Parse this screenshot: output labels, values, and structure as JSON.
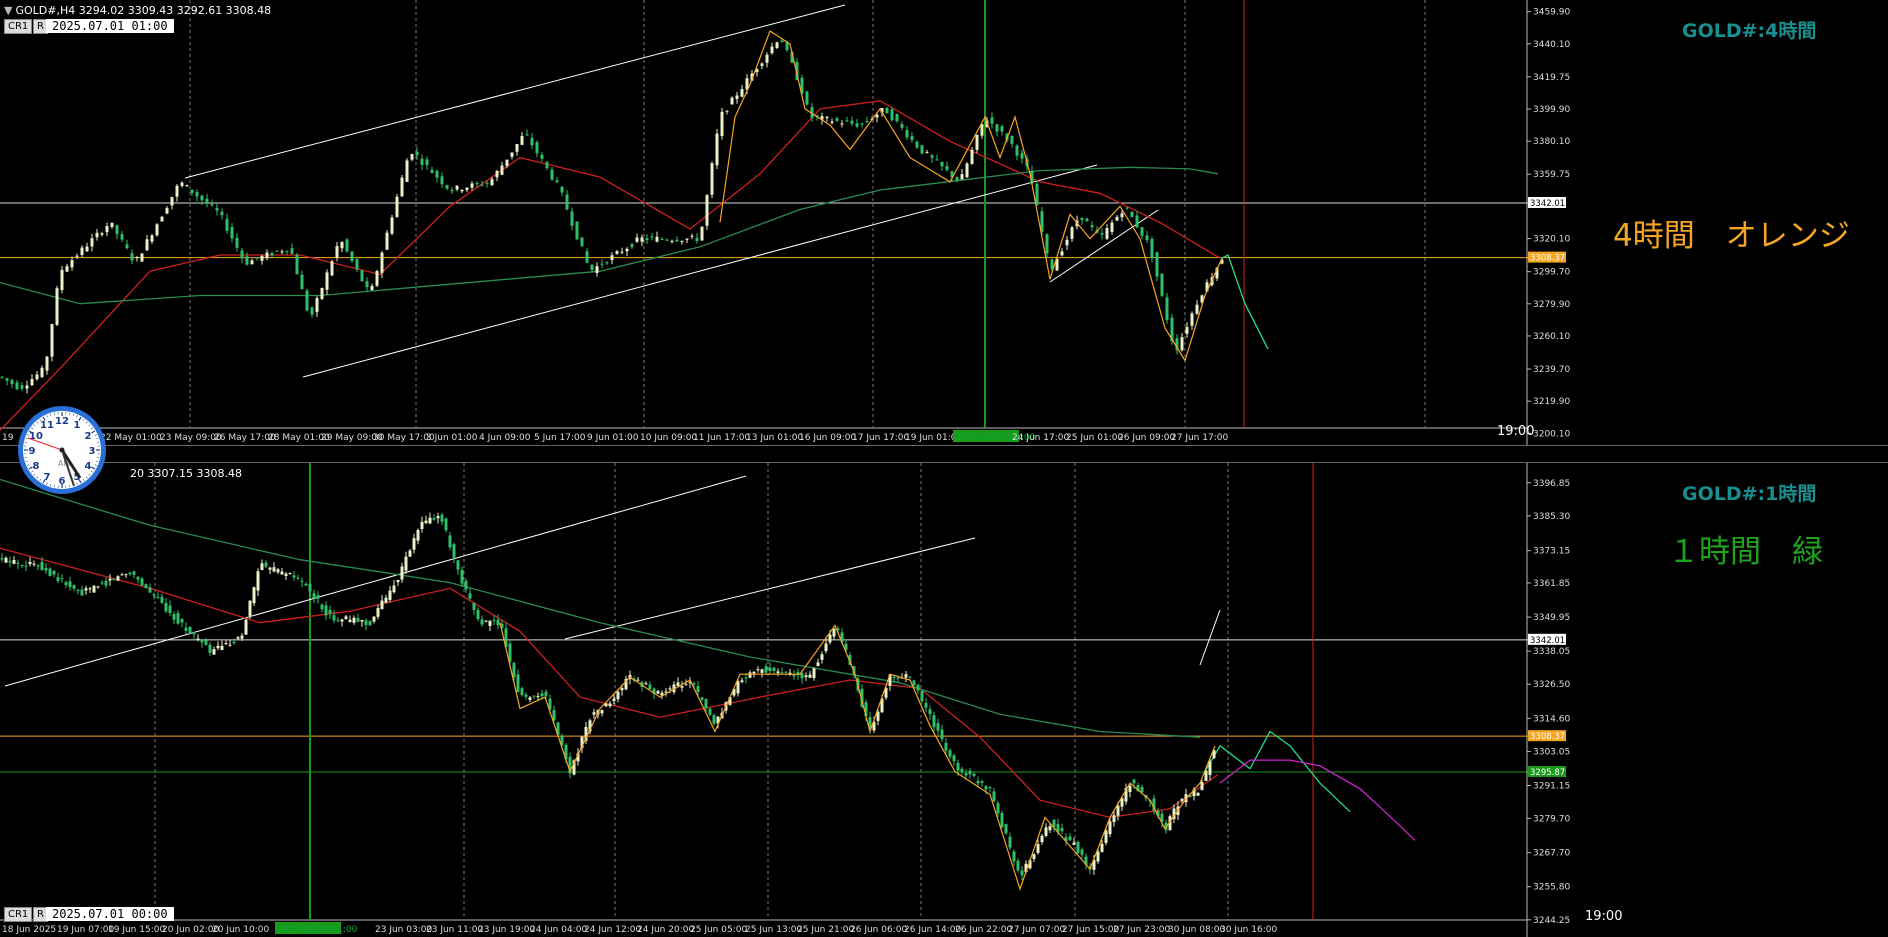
{
  "top": {
    "info": "GOLD#,H4  3294.02 3309.43 3292.61 3308.48",
    "cr_button": "CR1",
    "r_button": "R",
    "date_label": "2025.07.01 01:00",
    "symbol_title": "GOLD#:4時間",
    "annotation": "4時間　オレンジ",
    "annotation_color": "#f5a623",
    "time_marker": "19:00",
    "hline_white_price": "3342.01",
    "hline_orange_price": "3308.37",
    "x_labels": [
      "19",
      "22 May 01:00",
      "23 May 09:00",
      "26 May 17:00",
      "28 May 01:00",
      "29 May 09:00",
      "30 May 17:00",
      "3 Jun 01:00",
      "4 Jun 09:00",
      "5 Jun 17:00",
      "9 Jun 01:00",
      "10 Jun 09:00",
      "11 Jun 17:00",
      "13 Jun 01:00",
      "16 Jun 09:00",
      "17 Jun 17:00",
      "19 Jun 01:00",
      "2025.06.23 01:00",
      "24 Jun 17:00",
      "25 Jun 01:00",
      "26 Jun 09:00",
      "27 Jun 17:00"
    ]
  },
  "bottom": {
    "info": "20 3307.15 3308.48",
    "cr_button": "CR1",
    "r_button": "R",
    "date_label": "2025.07.01 00:00",
    "symbol_title": "GOLD#:1時間",
    "annotation": "１時間　緑",
    "annotation_color": "#1fa31f",
    "time_marker": "19:00",
    "hline_white_price": "3342.01",
    "hline_orange_price": "3308.37",
    "hline_green_price": "3295.87",
    "x_labels": [
      "18 Jun 2025",
      "19 Jun 07:00",
      "19 Jun 15:00",
      "20 Jun 02:00",
      "20 Jun 10:00",
      "2025.06.23 01:00",
      "23 Jun 03:00",
      "23 Jun 11:00",
      "23 Jun 19:00",
      "24 Jun 04:00",
      "24 Jun 12:00",
      "24 Jun 20:00",
      "25 Jun 05:00",
      "25 Jun 13:00",
      "25 Jun 21:00",
      "26 Jun 06:00",
      "26 Jun 14:00",
      "26 Jun 22:00",
      "27 Jun 07:00",
      "27 Jun 15:00",
      "27 Jun 23:00",
      "30 Jun 08:00",
      "30 Jun 16:00"
    ]
  },
  "clock": {
    "label": "AM",
    "numbers": [
      "12",
      "1",
      "2",
      "3",
      "4",
      "5",
      "6",
      "7",
      "8",
      "9",
      "10",
      "11"
    ]
  },
  "colors": {
    "bull": "#e8f0c8",
    "bear": "#2fbf6a",
    "ma_red": "#cc2020",
    "ma_green": "#2a8a50",
    "zigzag": "#f5a623",
    "trend": "#ffffff",
    "proj_green": "#22dd88",
    "proj_magenta": "#cc22cc",
    "marker_red": "#cc2020",
    "marker_green": "#1a9a1a"
  },
  "chart_data": [
    {
      "type": "candlestick",
      "title": "GOLD#:4時間",
      "timeframe": "H4",
      "x_labels": [
        "19",
        "22 May 01:00",
        "23 May 09:00",
        "26 May 17:00",
        "28 May 01:00",
        "29 May 09:00",
        "30 May 17:00",
        "3 Jun 01:00",
        "4 Jun 09:00",
        "5 Jun 17:00",
        "9 Jun 01:00",
        "10 Jun 09:00",
        "11 Jun 17:00",
        "13 Jun 01:00",
        "16 Jun 09:00",
        "17 Jun 17:00",
        "19 Jun 01:00",
        "2025.06.23 01:00",
        "24 Jun 17:00",
        "25 Jun 01:00",
        "26 Jun 09:00",
        "27 Jun 17:00"
      ],
      "y_ticks": [
        3459.9,
        3440.1,
        3419.75,
        3399.9,
        3380.1,
        3359.75,
        3342.01,
        3320.1,
        3308.37,
        3299.7,
        3279.9,
        3260.1,
        3239.7,
        3219.9,
        3200.1
      ],
      "ylim": [
        3196,
        3464
      ],
      "price_path": [
        [
          0,
          3235
        ],
        [
          20,
          3228
        ],
        [
          45,
          3240
        ],
        [
          60,
          3300
        ],
        [
          110,
          3330
        ],
        [
          135,
          3305
        ],
        [
          180,
          3355
        ],
        [
          220,
          3335
        ],
        [
          245,
          3305
        ],
        [
          290,
          3315
        ],
        [
          310,
          3270
        ],
        [
          340,
          3320
        ],
        [
          370,
          3285
        ],
        [
          410,
          3375
        ],
        [
          450,
          3350
        ],
        [
          490,
          3355
        ],
        [
          525,
          3385
        ],
        [
          560,
          3350
        ],
        [
          590,
          3300
        ],
        [
          640,
          3320
        ],
        [
          700,
          3320
        ],
        [
          720,
          3395
        ],
        [
          750,
          3420
        ],
        [
          780,
          3445
        ],
        [
          800,
          3415
        ],
        [
          810,
          3395
        ],
        [
          860,
          3390
        ],
        [
          885,
          3400
        ],
        [
          920,
          3375
        ],
        [
          960,
          3355
        ],
        [
          985,
          3395
        ],
        [
          1010,
          3380
        ],
        [
          1030,
          3360
        ],
        [
          1050,
          3300
        ],
        [
          1080,
          3335
        ],
        [
          1100,
          3320
        ],
        [
          1125,
          3340
        ],
        [
          1150,
          3315
        ],
        [
          1175,
          3250
        ],
        [
          1200,
          3285
        ],
        [
          1222,
          3308
        ]
      ],
      "series": [
        {
          "name": "MA red",
          "values": [
            [
              0,
              3202
            ],
            [
              60,
              3240
            ],
            [
              150,
              3300
            ],
            [
              220,
              3310
            ],
            [
              300,
              3310
            ],
            [
              380,
              3298
            ],
            [
              450,
              3340
            ],
            [
              520,
              3370
            ],
            [
              600,
              3358
            ],
            [
              690,
              3326
            ],
            [
              760,
              3360
            ],
            [
              820,
              3400
            ],
            [
              880,
              3405
            ],
            [
              950,
              3380
            ],
            [
              1040,
              3355
            ],
            [
              1100,
              3348
            ],
            [
              1160,
              3330
            ],
            [
              1220,
              3308
            ]
          ]
        },
        {
          "name": "MA green",
          "values": [
            [
              0,
              3293
            ],
            [
              80,
              3280
            ],
            [
              200,
              3285
            ],
            [
              320,
              3285
            ],
            [
              450,
              3292
            ],
            [
              600,
              3300
            ],
            [
              700,
              3315
            ],
            [
              800,
              3338
            ],
            [
              880,
              3350
            ],
            [
              960,
              3356
            ],
            [
              1040,
              3362
            ],
            [
              1130,
              3364
            ],
            [
              1190,
              3363
            ],
            [
              1218,
              3360
            ]
          ]
        },
        {
          "name": "Forecast",
          "values": [
            [
              1222,
              3308
            ],
            [
              1228,
              3310
            ],
            [
              1245,
              3280
            ],
            [
              1268,
              3252
            ]
          ]
        }
      ],
      "hlines": [
        3342.01,
        3308.37
      ]
    },
    {
      "type": "candlestick",
      "title": "GOLD#:1時間",
      "timeframe": "H1",
      "x_labels": [
        "18 Jun 2025",
        "19 Jun 07:00",
        "19 Jun 15:00",
        "20 Jun 02:00",
        "20 Jun 10:00",
        "2025.06.23 01:00",
        "23 Jun 03:00",
        "23 Jun 11:00",
        "23 Jun 19:00",
        "24 Jun 04:00",
        "24 Jun 12:00",
        "24 Jun 20:00",
        "25 Jun 05:00",
        "25 Jun 13:00",
        "25 Jun 21:00",
        "26 Jun 06:00",
        "26 Jun 14:00",
        "26 Jun 22:00",
        "27 Jun 07:00",
        "27 Jun 15:00",
        "27 Jun 23:00",
        "30 Jun 08:00",
        "30 Jun 16:00"
      ],
      "y_ticks": [
        3396.85,
        3385.3,
        3373.15,
        3361.85,
        3349.95,
        3342.01,
        3338.05,
        3326.5,
        3314.6,
        3308.37,
        3303.05,
        3295.87,
        3291.15,
        3279.7,
        3267.7,
        3255.8,
        3244.25
      ],
      "ylim": [
        3240,
        3402
      ],
      "price_path": [
        [
          0,
          3370
        ],
        [
          40,
          3368
        ],
        [
          80,
          3358
        ],
        [
          130,
          3366
        ],
        [
          180,
          3348
        ],
        [
          210,
          3338
        ],
        [
          240,
          3342
        ],
        [
          260,
          3368
        ],
        [
          300,
          3363
        ],
        [
          330,
          3350
        ],
        [
          370,
          3348
        ],
        [
          400,
          3365
        ],
        [
          420,
          3382
        ],
        [
          440,
          3386
        ],
        [
          460,
          3363
        ],
        [
          480,
          3348
        ],
        [
          500,
          3348
        ],
        [
          520,
          3322
        ],
        [
          545,
          3323
        ],
        [
          570,
          3296
        ],
        [
          590,
          3315
        ],
        [
          610,
          3320
        ],
        [
          630,
          3329
        ],
        [
          660,
          3323
        ],
        [
          690,
          3328
        ],
        [
          715,
          3312
        ],
        [
          740,
          3328
        ],
        [
          760,
          3332
        ],
        [
          790,
          3330
        ],
        [
          810,
          3329
        ],
        [
          835,
          3347
        ],
        [
          850,
          3334
        ],
        [
          870,
          3310
        ],
        [
          890,
          3329
        ],
        [
          910,
          3329
        ],
        [
          930,
          3315
        ],
        [
          955,
          3298
        ],
        [
          990,
          3290
        ],
        [
          1020,
          3259
        ],
        [
          1050,
          3278
        ],
        [
          1075,
          3270
        ],
        [
          1090,
          3261
        ],
        [
          1110,
          3278
        ],
        [
          1130,
          3292
        ],
        [
          1150,
          3286
        ],
        [
          1165,
          3276
        ],
        [
          1180,
          3286
        ],
        [
          1200,
          3290
        ],
        [
          1215,
          3305
        ]
      ],
      "series": [
        {
          "name": "MA red",
          "values": [
            [
              0,
              3374
            ],
            [
              150,
              3360
            ],
            [
              260,
              3348
            ],
            [
              350,
              3352
            ],
            [
              450,
              3360
            ],
            [
              520,
              3345
            ],
            [
              580,
              3322
            ],
            [
              660,
              3315
            ],
            [
              760,
              3322
            ],
            [
              850,
              3328
            ],
            [
              920,
              3325
            ],
            [
              980,
              3308
            ],
            [
              1040,
              3286
            ],
            [
              1110,
              3280
            ],
            [
              1170,
              3283
            ],
            [
              1218,
              3295
            ]
          ]
        },
        {
          "name": "MA green",
          "values": [
            [
              0,
              3398
            ],
            [
              150,
              3382
            ],
            [
              300,
              3370
            ],
            [
              450,
              3362
            ],
            [
              600,
              3348
            ],
            [
              750,
              3336
            ],
            [
              900,
              3327
            ],
            [
              1000,
              3316
            ],
            [
              1100,
              3310
            ],
            [
              1200,
              3308
            ]
          ]
        },
        {
          "name": "Forecast green",
          "values": [
            [
              1205,
              3296
            ],
            [
              1220,
              3305
            ],
            [
              1250,
              3297
            ],
            [
              1270,
              3310
            ],
            [
              1290,
              3305
            ],
            [
              1320,
              3292
            ],
            [
              1350,
              3282
            ]
          ]
        },
        {
          "name": "Forecast magenta",
          "values": [
            [
              1220,
              3292
            ],
            [
              1250,
              3300
            ],
            [
              1290,
              3300
            ],
            [
              1320,
              3298
            ],
            [
              1360,
              3290
            ],
            [
              1385,
              3282
            ],
            [
              1415,
              3272
            ]
          ]
        }
      ],
      "hlines": [
        3342.01,
        3308.37,
        3295.87
      ]
    }
  ]
}
